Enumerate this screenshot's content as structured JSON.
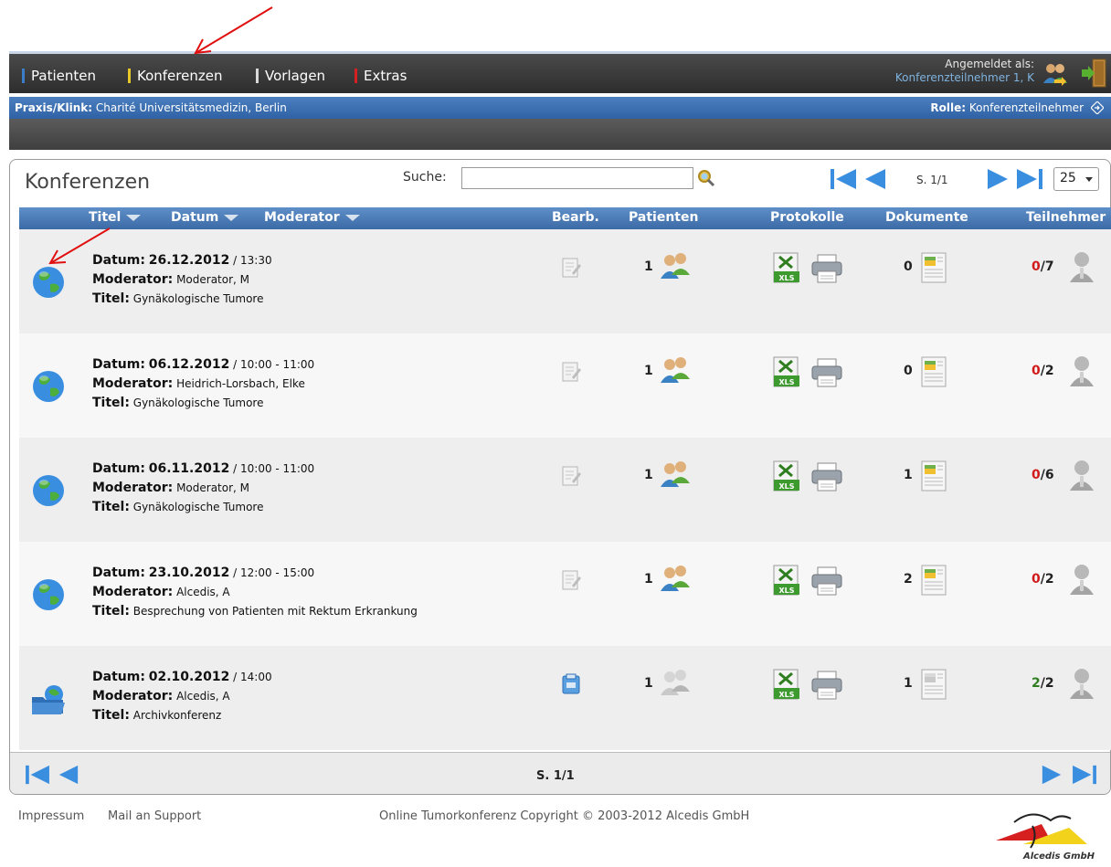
{
  "nav": {
    "items": [
      {
        "label": "Patienten",
        "color": "#3a7ec8"
      },
      {
        "label": "Konferenzen",
        "color": "#e6c928"
      },
      {
        "label": "Vorlagen",
        "color": "#d9d9d9"
      },
      {
        "label": "Extras",
        "color": "#d42020"
      }
    ],
    "login_label": "Angemeldet als:",
    "login_user": "Konferenzteilnehmer 1, K"
  },
  "praxis": {
    "label": "Praxis/Klink:",
    "value": "Charité Universitätsmedizin, Berlin",
    "rolle_label": "Rolle:",
    "rolle_value": "Konferenzteilnehmer"
  },
  "main": {
    "title": "Konferenzen",
    "search_label": "Suche:",
    "search_value": "",
    "page": "S. 1/1",
    "per_page": "25",
    "columns": {
      "titel": "Titel",
      "datum": "Datum",
      "moderator": "Moderator",
      "bearb": "Bearb.",
      "patienten": "Patienten",
      "protokolle": "Protokolle",
      "dokumente": "Dokumente",
      "teilnehmer": "Teilnehmer"
    },
    "field_labels": {
      "datum": "Datum:",
      "moderator": "Moderator:",
      "titel": "Titel:"
    },
    "rows": [
      {
        "date": "26.12.2012",
        "time": "/ 13:30",
        "moderator": "Moderator, M",
        "title": "Gynäkologische Tumore",
        "patients": "1",
        "docs": "0",
        "present": "0",
        "total": "/7",
        "status": "globe"
      },
      {
        "date": "06.12.2012",
        "time": "/ 10:00 - 11:00",
        "moderator": "Heidrich-Lorsbach, Elke",
        "title": "Gynäkologische Tumore",
        "patients": "1",
        "docs": "0",
        "present": "0",
        "total": "/2",
        "status": "globe"
      },
      {
        "date": "06.11.2012",
        "time": "/ 10:00 - 11:00",
        "moderator": "Moderator, M",
        "title": "Gynäkologische Tumore",
        "patients": "1",
        "docs": "1",
        "present": "0",
        "total": "/6",
        "status": "globe"
      },
      {
        "date": "23.10.2012",
        "time": "/ 12:00 - 15:00",
        "moderator": "Alcedis, A",
        "title": "Besprechung von Patienten mit Rektum Erkrankung",
        "patients": "1",
        "docs": "2",
        "present": "0",
        "total": "/2",
        "status": "globe"
      },
      {
        "date": "02.10.2012",
        "time": "/ 14:00",
        "moderator": "Alcedis, A",
        "title": "Archivkonferenz",
        "patients": "1",
        "docs": "1",
        "present": "2",
        "total": "/2",
        "status": "folder-globe"
      }
    ]
  },
  "footer": {
    "impressum": "Impressum",
    "mail": "Mail an Support",
    "copyright": "Online Tumorkonferenz Copyright © 2003-2012 Alcedis GmbH",
    "logo_text": "Alcedis GmbH"
  }
}
